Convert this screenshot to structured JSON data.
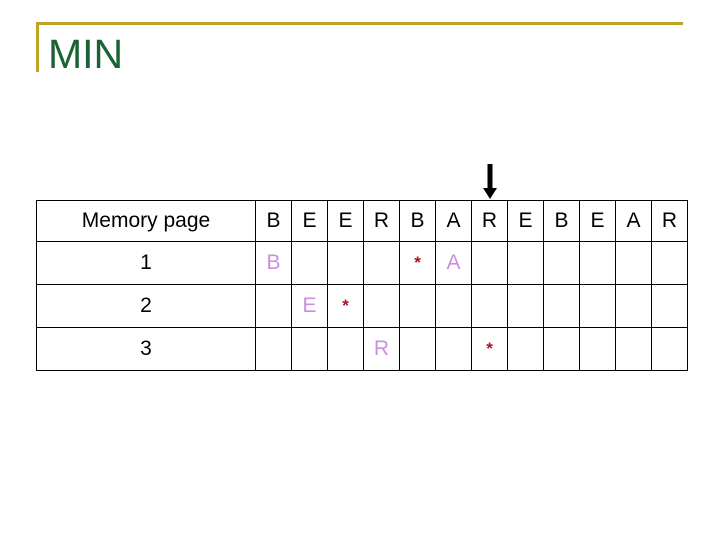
{
  "slide": {
    "title": "MIN",
    "title_color": "#1a6334",
    "rule_color": "#bfa326"
  },
  "arrow": {
    "name": "down-arrow",
    "color": "#000000",
    "points_to_column_index": 6
  },
  "table": {
    "row_header_label": "Memory page",
    "reference_string": [
      "B",
      "E",
      "E",
      "R",
      "B",
      "A",
      "R",
      "E",
      "B",
      "E",
      "A",
      "R"
    ],
    "frame_letter_color": "#cb8fdd",
    "fault_mark_color": "#a81420",
    "fault_symbol": "*",
    "rows": [
      {
        "label": "1",
        "cells": [
          "B",
          "",
          "",
          "",
          "*",
          "A",
          "",
          "",
          "",
          "",
          "",
          ""
        ],
        "kinds": [
          "frame",
          "",
          "",
          "",
          "fault",
          "frame",
          "",
          "",
          "",
          "",
          "",
          ""
        ]
      },
      {
        "label": "2",
        "cells": [
          "",
          "E",
          "*",
          "",
          "",
          "",
          "",
          "",
          "",
          "",
          "",
          ""
        ],
        "kinds": [
          "",
          "frame",
          "fault",
          "",
          "",
          "",
          "",
          "",
          "",
          "",
          "",
          ""
        ]
      },
      {
        "label": "3",
        "cells": [
          "",
          "",
          "",
          "R",
          "",
          "",
          "*",
          "",
          "",
          "",
          "",
          ""
        ],
        "kinds": [
          "",
          "",
          "",
          "frame",
          "",
          "",
          "fault",
          "",
          "",
          "",
          "",
          ""
        ]
      }
    ]
  }
}
